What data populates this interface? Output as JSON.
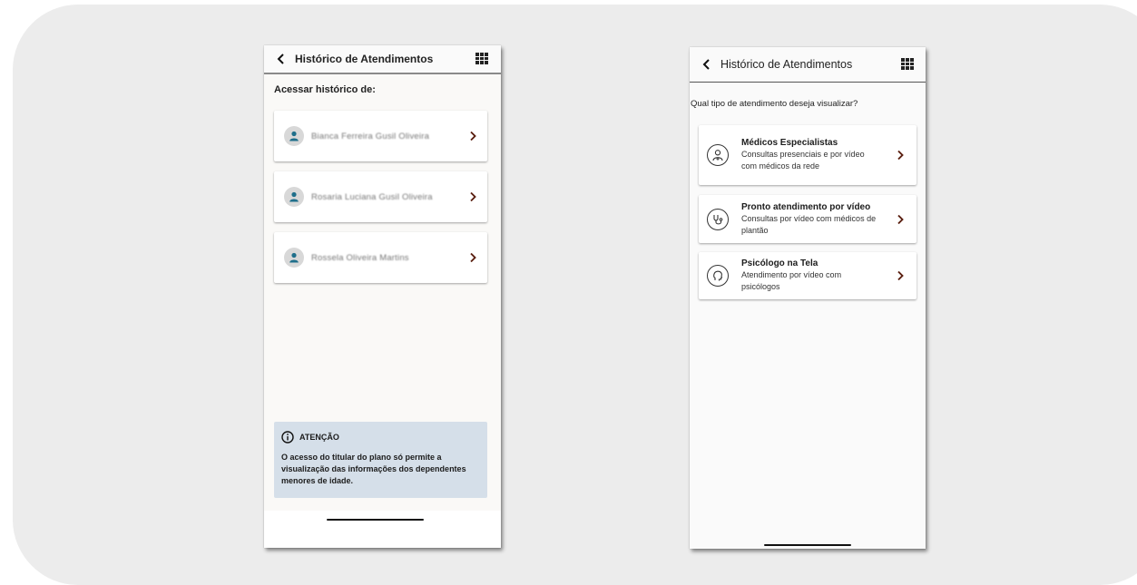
{
  "left_screen": {
    "header_title": "Histórico de Atendimentos",
    "section_label": "Acessar histórico de:",
    "dependents": [
      {
        "name": "Bianca Ferreira Gusil Oliveira"
      },
      {
        "name": "Rosaria Luciana Gusil Oliveira"
      },
      {
        "name": "Rossela Oliveira Martins"
      }
    ],
    "notice": {
      "title": "ATENÇÃO",
      "text": "O acesso do titular do plano só permite a visualização das informações dos dependentes menores de idade."
    }
  },
  "right_screen": {
    "header_title": "Histórico de Atendimentos",
    "section_label": "Qual tipo de atendimento deseja visualizar?",
    "services": [
      {
        "title": "Médicos Especialistas",
        "description": "Consultas presenciais e por vídeo com médicos da rede",
        "icon": "doctor-icon"
      },
      {
        "title": "Pronto atendimento por vídeo",
        "description": "Consultas por vídeo com médicos de plantão",
        "icon": "stethoscope-icon"
      },
      {
        "title": "Psicólogo na Tela",
        "description": "Atendimento por vídeo com psicólogos",
        "icon": "head-icon"
      }
    ]
  },
  "colors": {
    "backdrop": "#ececec",
    "avatar_icon": "#1f6f8b",
    "notice_bg": "#d5dfe9",
    "chevron": "#5a1f10"
  }
}
